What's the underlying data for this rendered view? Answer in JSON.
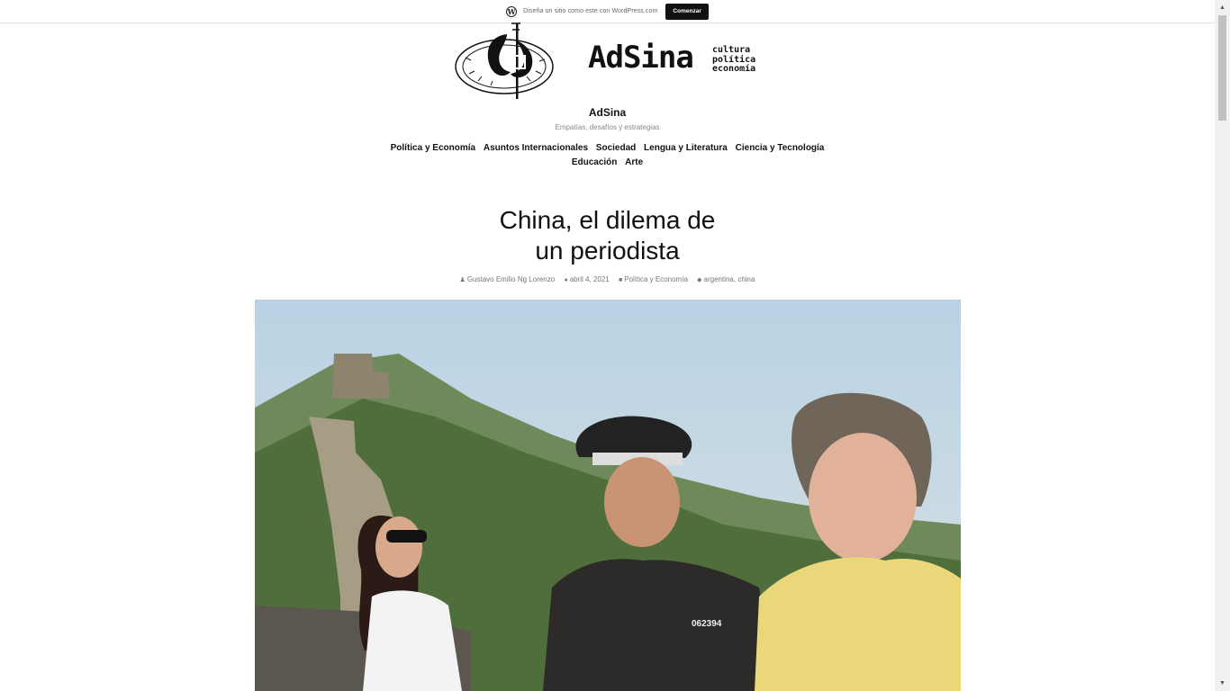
{
  "wpbar": {
    "text": "Diseña un sitio como este con WordPress.com",
    "button": "Comenzar"
  },
  "site": {
    "logo_name": "AdSina",
    "logo_tags": [
      "cultura",
      "política",
      "economía"
    ],
    "title": "AdSina",
    "description": "Empatías, desafíos y estrategias"
  },
  "nav": {
    "items": [
      "Política y Economía",
      "Asuntos Internacionales",
      "Sociedad",
      "Lengua y Literatura",
      "Ciencia y Tecnología",
      "Educación",
      "Arte"
    ]
  },
  "post": {
    "title_line1": "China, el dilema de",
    "title_line2": "un periodista",
    "author": "Gustavo Emilio Ng Lorenzo",
    "date": "abril 4, 2021",
    "category": "Política y Economía",
    "tags": "argentina, china",
    "badge_number": "062394"
  },
  "icons": {
    "wp": "wordpress-icon",
    "author": "person-icon",
    "date": "clock-icon",
    "category": "folder-icon",
    "tags": "tag-icon"
  }
}
